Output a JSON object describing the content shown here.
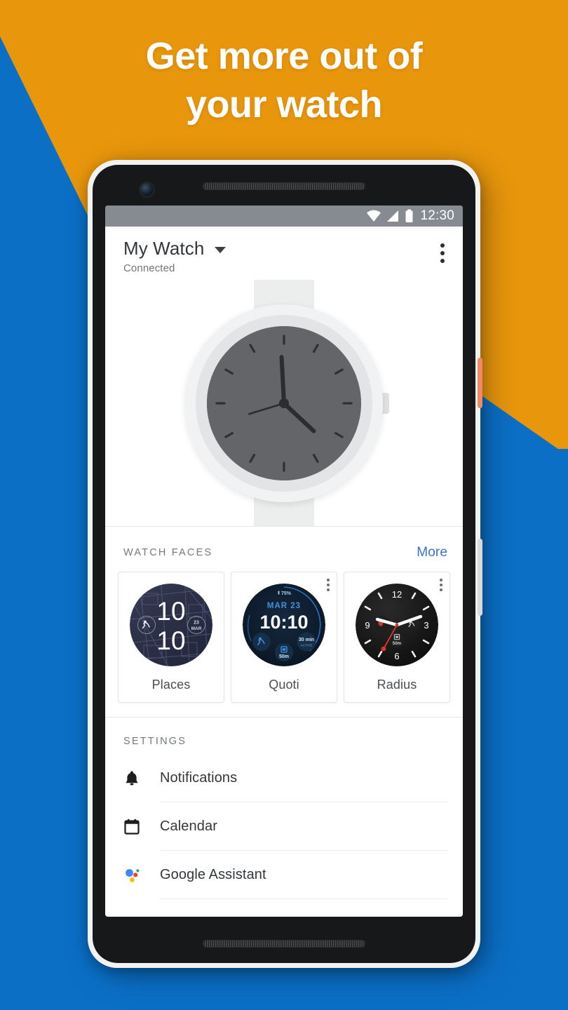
{
  "promo": {
    "headline_line1": "Get more out of",
    "headline_line2": "your watch",
    "bg_orange": "#e8960c",
    "bg_blue": "#0b6fc6"
  },
  "statusbar": {
    "time": "12:30",
    "wifi_icon": "wifi-icon",
    "signal_icon": "cellular-signal-icon",
    "battery_icon": "battery-icon",
    "background": "#858b90"
  },
  "appbar": {
    "title": "My Watch",
    "subtitle": "Connected",
    "dropdown_icon": "chevron-down-icon",
    "overflow_icon": "overflow-menu-icon"
  },
  "hero": {
    "watch_face_color": "#636568",
    "watch_body_color": "#f1f2f3",
    "strap_color": "#eceded",
    "tick_count": 12,
    "hour_hand_angle": 133,
    "minute_hand_angle": 357,
    "second_hand_angle": 253
  },
  "watch_faces": {
    "title": "WATCH FACES",
    "action": "More",
    "action_color": "#3b6fd4",
    "cards": [
      {
        "name": "Places",
        "style": "places",
        "time_top": "10",
        "time_bottom": "10",
        "date": "23",
        "month": "MAR",
        "left_complication": "runner-icon",
        "bg_color": "#2b2f45",
        "has_menu": false
      },
      {
        "name": "Quoti",
        "style": "quoti",
        "battery": "75%",
        "date": "MAR 23",
        "time": "10:10",
        "distance": "50m",
        "active_value": "30 min",
        "active_label": "ACTIVE",
        "left_complication": "runner-icon",
        "bottom_complication": "calendar-icon",
        "bg_color": "#0d1a2b",
        "accent_color": "#2f7fd1",
        "has_menu": true
      },
      {
        "name": "Radius",
        "style": "radius",
        "numerals": [
          "12",
          "3",
          "6",
          "9"
        ],
        "bg_color": "#141414",
        "second_hand_color": "#d8382a",
        "complication_distance": "50m",
        "right_complication": "runner-icon",
        "bottom_complication": "calendar-icon",
        "has_menu": true
      }
    ]
  },
  "settings": {
    "title": "SETTINGS",
    "items": [
      {
        "label": "Notifications",
        "icon": "bell-icon"
      },
      {
        "label": "Calendar",
        "icon": "calendar-icon"
      },
      {
        "label": "Google Assistant",
        "icon": "google-assistant-icon"
      }
    ]
  }
}
